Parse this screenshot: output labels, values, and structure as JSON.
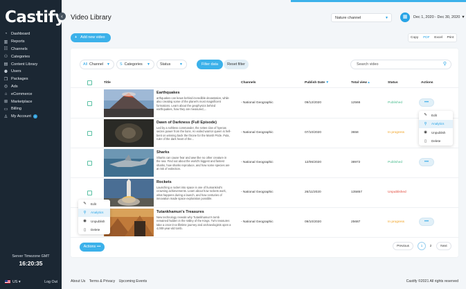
{
  "app": {
    "name": "Castify"
  },
  "sidebar": {
    "items": [
      {
        "label": "Dashboard",
        "icon": "dashboard-icon"
      },
      {
        "label": "Reports",
        "icon": "reports-icon"
      },
      {
        "label": "Channels",
        "icon": "channels-icon"
      },
      {
        "label": "Categories",
        "icon": "categories-icon"
      },
      {
        "label": "Content Library",
        "icon": "content-library-icon"
      },
      {
        "label": "Users",
        "icon": "users-icon"
      },
      {
        "label": "Packages",
        "icon": "packages-icon"
      },
      {
        "label": "Ads",
        "icon": "ads-icon"
      },
      {
        "label": "eCommerce",
        "icon": "ecommerce-icon"
      },
      {
        "label": "Marketplace",
        "icon": "marketplace-icon"
      },
      {
        "label": "Billing",
        "icon": "billing-icon"
      },
      {
        "label": "My Account",
        "icon": "account-icon"
      }
    ],
    "timezone_label": "Server Timezone GMT",
    "time": "16:20:35",
    "locale": "US",
    "logout": "Log Out"
  },
  "header": {
    "title": "Video Library",
    "channel": "Nature channel",
    "date_range": "Dec 1, 2020 - Dec 30, 2020"
  },
  "toolbar": {
    "add_label": "Add new video",
    "export": [
      "Copy",
      "PDF",
      "Excel",
      "Print"
    ]
  },
  "filters": {
    "all": "All",
    "channel": "Channel",
    "s": "S",
    "categories": "Categories",
    "status": "Status",
    "filter_btn": "Filter data",
    "reset_btn": "Reset filter",
    "search_placeholder": "Search video"
  },
  "table": {
    "columns": {
      "title": "Title",
      "channels": "Channels",
      "publish_date": "Publish Date",
      "total_view": "Total view",
      "status": "Status",
      "actions": "Actions"
    },
    "rows": [
      {
        "title": "Earthquakes",
        "desc": "arthquakes can leave behind incredible devastation, while also creating some of the planet's most magnificent formations. Learn about the geophysics behind earthquakes, how they are measured,...",
        "channel": "- National Geographic",
        "date": "09/12/2020",
        "views": "12566",
        "status": "Published",
        "thumb": "volcano"
      },
      {
        "title": "Dawn of Darkness (Full Episode)",
        "desc": "Led by a ruthless commander, the rotten clan of hyenas seizes power from the lions. An exiled warrior queen is hell-bent on winning back the throne for the Marsh Pride. Pula, ruler of the dark heart of the...",
        "channel": "- National Geographic",
        "date": "07/10/2020",
        "views": "3658",
        "status": "In progress",
        "thumb": "dark"
      },
      {
        "title": "Sharks",
        "desc": "Sharks can cause fear and awe like no other creature in the sea. Find out about the world's biggest and fastest sharks, how sharks reproduce, and how some species are at risk of extinction.",
        "channel": "- National Geographic",
        "date": "12/06/2020",
        "views": "38972",
        "status": "Published",
        "thumb": "shark"
      },
      {
        "title": "Rockets",
        "desc": "Launching a rocket into space is one of humankind's crowning achievements. Learn about how rockets work, what happens during a launch, and how centuries of innovation made space exploration possible.",
        "channel": "- National Geographic",
        "date": "26/11/2020",
        "views": "135857",
        "status": "Unpublished",
        "thumb": "rocket"
      },
      {
        "title": "Tutankhamun's Treasures",
        "desc": "New technology reveals why Tutankhamun's tomb remained hidden in the Valley of the Kings. Tut's treasures take a once-in-a-lifetime journey and archaeologists open a 4,000-year-old tomb.",
        "channel": "- National Geographic",
        "date": "09/10/2020",
        "views": "25687",
        "status": "In progress",
        "thumb": "egypt"
      }
    ],
    "action_dots": "•••"
  },
  "row_menu": [
    {
      "label": "Edit",
      "icon": "edit-icon"
    },
    {
      "label": "Analytics",
      "icon": "analytics-icon"
    },
    {
      "label": "Unpublish",
      "icon": "unpublish-icon"
    },
    {
      "label": "Delete",
      "icon": "delete-icon"
    }
  ],
  "bulk": {
    "actions_label": "Actions •••",
    "menu": [
      {
        "label": "Edit",
        "icon": "edit-icon"
      },
      {
        "label": "Analytics",
        "icon": "analytics-icon"
      },
      {
        "label": "Unpublish",
        "icon": "unpublish-icon"
      },
      {
        "label": "Delete",
        "icon": "delete-icon"
      }
    ]
  },
  "pagination": {
    "previous": "Previous",
    "pages": [
      "1",
      "2"
    ],
    "next": "Next"
  },
  "footer": {
    "links": [
      "About Us",
      "Terms & Privacy",
      "Upcoming Events"
    ],
    "copyright": "Castify ©2021 All rights reserved"
  },
  "colors": {
    "accent": "#3cb1ea",
    "published": "#4cbc8f",
    "in_progress": "#f0a01e",
    "unpublished": "#e2483a",
    "sidebar": "#1b2733"
  }
}
